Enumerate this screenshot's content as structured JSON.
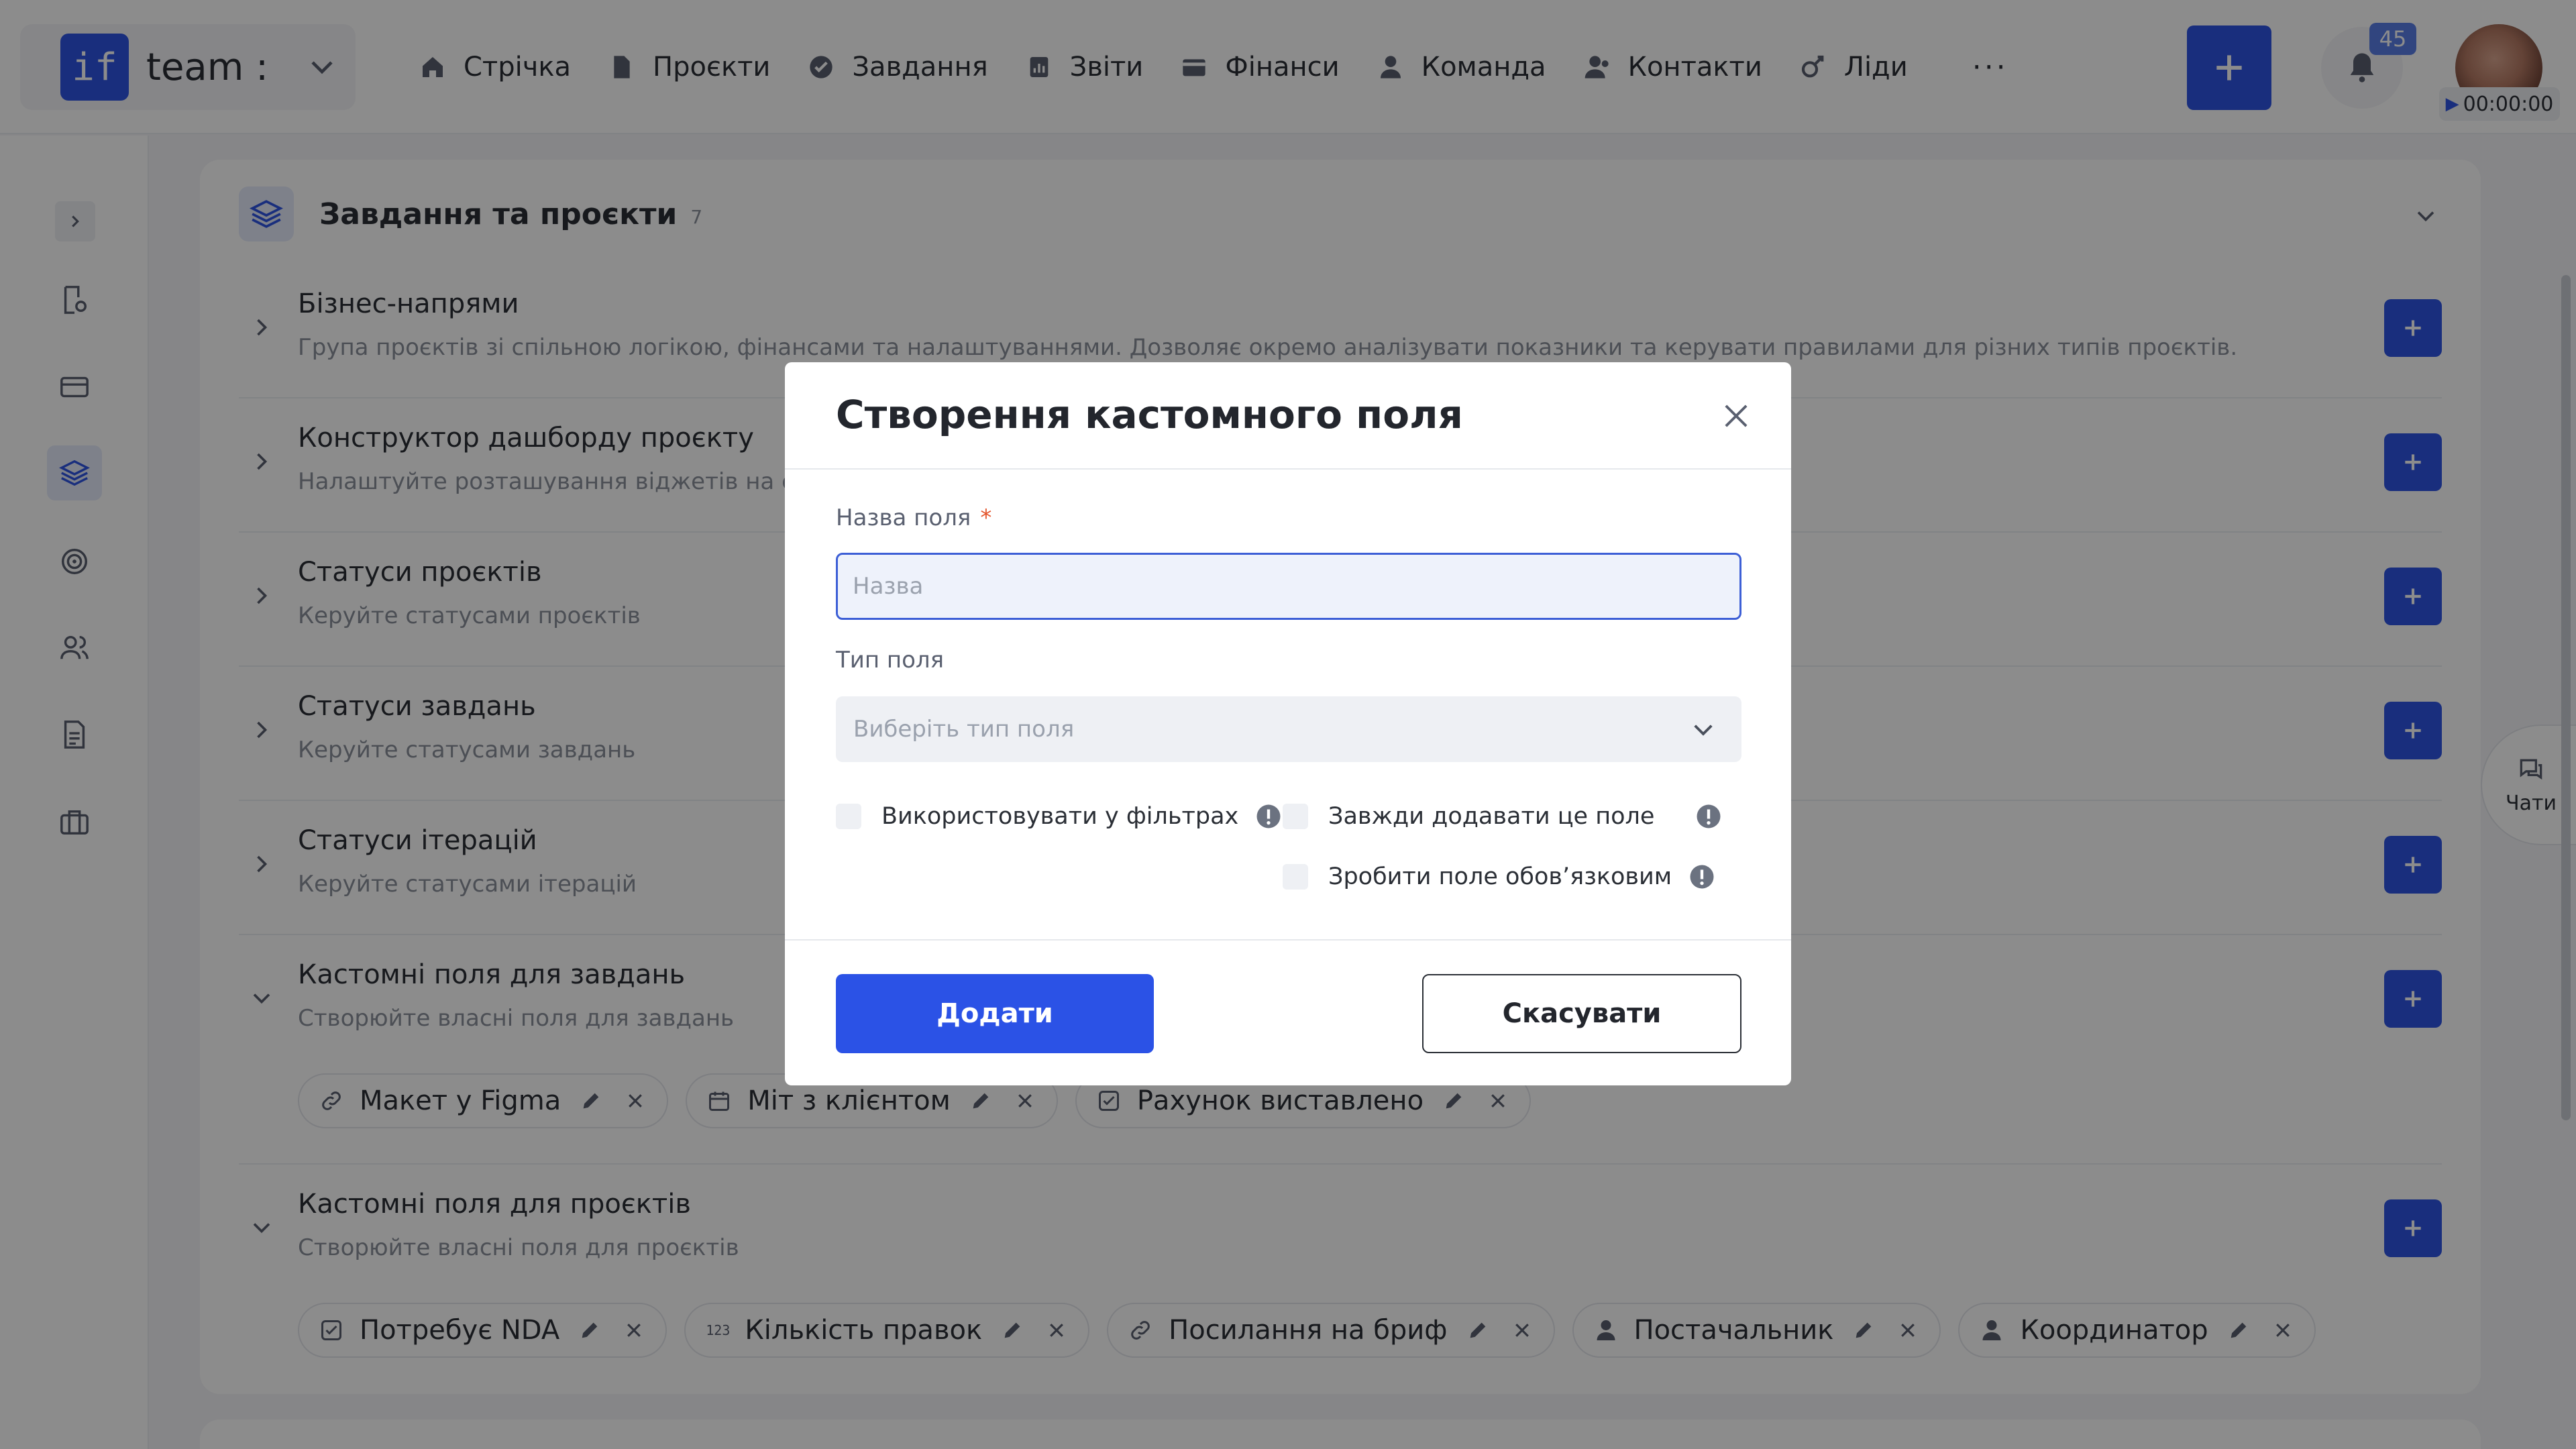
{
  "colors": {
    "accent": "#2f55e4",
    "badge": "#5a7ee8",
    "required": "#e4572e"
  },
  "topbar": {
    "team_logo": "if",
    "team_name": "team :",
    "nav": [
      {
        "label": "Стрічка",
        "icon": "home-icon"
      },
      {
        "label": "Проєкти",
        "icon": "file-icon"
      },
      {
        "label": "Завдання",
        "icon": "check-circle-icon"
      },
      {
        "label": "Звіти",
        "icon": "report-icon"
      },
      {
        "label": "Фінанси",
        "icon": "wallet-icon"
      },
      {
        "label": "Команда",
        "icon": "user-icon"
      },
      {
        "label": "Контакти",
        "icon": "contacts-icon"
      },
      {
        "label": "Ліди",
        "icon": "leads-icon"
      }
    ],
    "more": "···",
    "notifications_count": "45",
    "timer": "00:00:00"
  },
  "main": {
    "title": "Завдання та проєкти",
    "count": "7",
    "sections": [
      {
        "title": "Бізнес-напрями",
        "desc": "Група проєктів зі спільною логікою, фінансами та налаштуваннями. Дозволяє окремо аналізувати показники та керувати правилами для різних типів проєктів."
      },
      {
        "title": "Конструктор дашборду проєкту",
        "desc": "Налаштуйте розташування віджетів на сторінці проєкту"
      },
      {
        "title": "Статуси проєктів",
        "desc": "Керуйте статусами проєктів"
      },
      {
        "title": "Статуси завдань",
        "desc": "Керуйте статусами завдань"
      },
      {
        "title": "Статуси ітерацій",
        "desc": "Керуйте статусами ітерацій"
      },
      {
        "title": "Кастомні поля для завдань",
        "desc": "Створюйте власні поля для завдань"
      },
      {
        "title": "Кастомні поля для проєктів",
        "desc": "Створюйте власні поля для проєктів"
      }
    ],
    "task_fields": [
      {
        "label": "Макет у Figma",
        "icon": "link-icon"
      },
      {
        "label": "Міт з клієнтом",
        "icon": "calendar-icon"
      },
      {
        "label": "Рахунок виставлено",
        "icon": "checkbox-icon"
      }
    ],
    "project_fields": [
      {
        "label": "Потребує NDA",
        "icon": "checkbox-icon"
      },
      {
        "label": "Кількість правок",
        "icon": "number-icon",
        "num": "123"
      },
      {
        "label": "Посилання на бриф",
        "icon": "link-icon"
      },
      {
        "label": "Постачальник",
        "icon": "user-icon"
      },
      {
        "label": "Координатор",
        "icon": "user-icon"
      }
    ]
  },
  "chats": {
    "label": "Чати"
  },
  "modal": {
    "title": "Створення кастомного поля",
    "name_label": "Назва поля",
    "required_mark": "*",
    "name_value": "",
    "name_placeholder": "Назва",
    "type_label": "Тип поля",
    "type_placeholder": "Виберіть тип поля",
    "check_filters": "Використовувати у фільтрах",
    "check_always": "Завжди додавати це поле",
    "check_required": "Зробити поле обов’язковим",
    "add_label": "Додати",
    "cancel_label": "Скасувати"
  }
}
